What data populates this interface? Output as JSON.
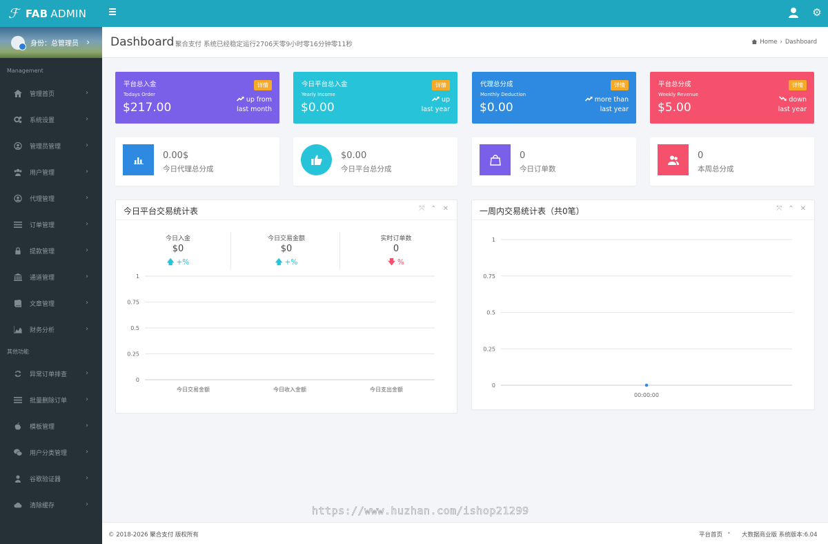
{
  "topbar": {
    "logo_mark": "ℱ",
    "brand_bold": "FAB",
    "brand_rest": "ADMIN",
    "menu_icon": "hamburger-icon",
    "user_icon": "user-icon",
    "settings_icon": "gear-icon"
  },
  "sidebar": {
    "user_role": "身份：总管理员",
    "section_main": "Management",
    "section_other": "其他功能",
    "items_main": [
      {
        "label": "管理首页",
        "icon": "home-icon"
      },
      {
        "label": "系统设置",
        "icon": "cogs-icon"
      },
      {
        "label": "管理员管理",
        "icon": "user-circle-icon"
      },
      {
        "label": "用户管理",
        "icon": "users-icon"
      },
      {
        "label": "代理管理",
        "icon": "user-circle-icon"
      },
      {
        "label": "订单管理",
        "icon": "list-icon"
      },
      {
        "label": "提款管理",
        "icon": "lock-icon"
      },
      {
        "label": "通道管理",
        "icon": "bank-icon"
      },
      {
        "label": "文章管理",
        "icon": "book-icon"
      },
      {
        "label": "财务分析",
        "icon": "area-chart-icon"
      }
    ],
    "items_other": [
      {
        "label": "异常订单排查",
        "icon": "refresh-icon"
      },
      {
        "label": "批量删除订单",
        "icon": "list-icon"
      },
      {
        "label": "模板管理",
        "icon": "apple-icon"
      },
      {
        "label": "用户分类管理",
        "icon": "wechat-icon"
      },
      {
        "label": "谷歌验证器",
        "icon": "user-icon"
      },
      {
        "label": "清除缓存",
        "icon": "cloud-icon"
      }
    ]
  },
  "header": {
    "title": "Dashboard",
    "subtitle": "聚合支付 系统已经稳定运行2706天零9小时零16分钟零11秒",
    "crumb_home": "Home",
    "crumb_sep": "›",
    "crumb_current": "Dashboard"
  },
  "stats": [
    {
      "title": "平台总入金",
      "sub": "Todays Order",
      "value": "$217.00",
      "badge": "详情",
      "trend1": "up from",
      "trend2": "last month",
      "dir": "up",
      "color": "#7a5fe8"
    },
    {
      "title": "今日平台总入金",
      "sub": "Yearly Income",
      "value": "$0.00",
      "badge": "详情",
      "trend1": "up",
      "trend2": "last year",
      "dir": "up",
      "color": "#27c3d9"
    },
    {
      "title": "代理总分成",
      "sub": "Monthly Deduction",
      "value": "$0.00",
      "badge": "详情",
      "trend1": "more than",
      "trend2": "last year",
      "dir": "up",
      "color": "#2d8ae0"
    },
    {
      "title": "平台总分成",
      "sub": "Weekly Revenue",
      "value": "$5.00",
      "badge": "详情",
      "trend1": "down",
      "trend2": "last year",
      "dir": "down",
      "color": "#f5506c"
    }
  ],
  "infos": [
    {
      "value": "0.00$",
      "label": "今日代理总分成",
      "icon": "bar-chart-icon",
      "color": "#2d8ae0",
      "round": false
    },
    {
      "value": "$0.00",
      "label": "今日平台总分成",
      "icon": "thumbs-up-icon",
      "color": "#27c3d9",
      "round": true
    },
    {
      "value": "0",
      "label": "今日订单数",
      "icon": "shopping-bag-icon",
      "color": "#7a5fe8",
      "round": false
    },
    {
      "value": "0",
      "label": "本周总分成",
      "icon": "users-icon",
      "color": "#f5506c",
      "round": false
    }
  ],
  "panel_today": {
    "title": "今日平台交易统计表",
    "controls": [
      "⤧",
      "⌃",
      "✕"
    ],
    "kpis": [
      {
        "label": "今日入金",
        "value": "$0",
        "delta": "+%",
        "dir": "up",
        "color": "#27c3d9"
      },
      {
        "label": "今日交易金额",
        "value": "$0",
        "delta": "+%",
        "dir": "up",
        "color": "#27c3d9"
      },
      {
        "label": "实时订单数",
        "value": "0",
        "delta": "%",
        "dir": "down",
        "color": "#f5506c"
      }
    ]
  },
  "panel_week": {
    "title": "一周内交易统计表（共0笔）",
    "controls": [
      "⤧",
      "⌃",
      "✕"
    ]
  },
  "chart_data": [
    {
      "type": "bar",
      "categories": [
        "今日交易金额",
        "今日收入金额",
        "今日支出金额"
      ],
      "values": [
        0,
        0,
        0
      ],
      "ylim": [
        0,
        1
      ],
      "yticks": [
        "0",
        "0.25",
        "0.5",
        "0.75",
        "1"
      ],
      "grid": true
    },
    {
      "type": "line",
      "x": [
        "00:00:00"
      ],
      "values": [
        0
      ],
      "ylim": [
        0,
        1
      ],
      "yticks": [
        "0",
        "0.25",
        "0.5",
        "0.75",
        "1"
      ],
      "grid": true,
      "color": "#2d8ae0"
    }
  ],
  "footer": {
    "copyright": "© 2018-2026 聚合支付 版权所有",
    "link_home": "平台首页",
    "dot": "•",
    "edition": "大数据商业版 系统版本:6.04"
  },
  "watermark": "https://www.huzhan.com/ishop21299"
}
